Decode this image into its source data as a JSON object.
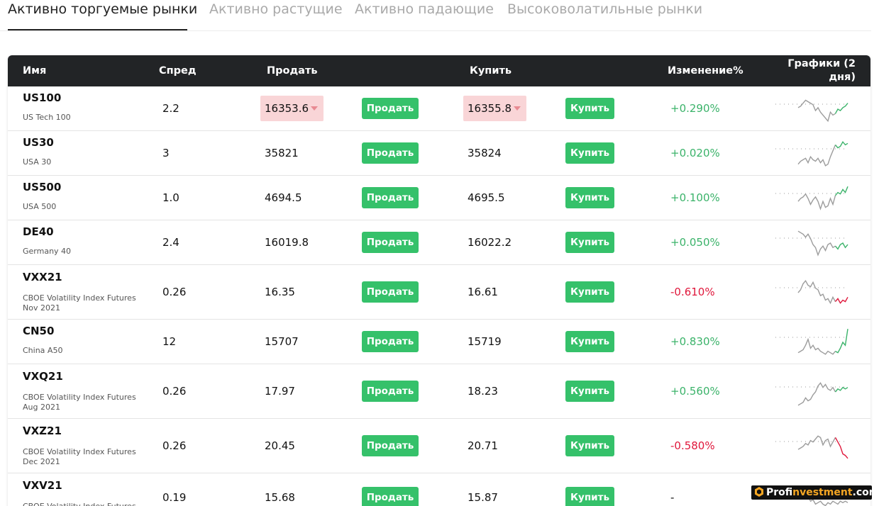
{
  "tabs": [
    {
      "label": "Активно торгуемые рынки",
      "active": true
    },
    {
      "label": "Активно растущие",
      "active": false
    },
    {
      "label": "Активно падающие",
      "active": false
    },
    {
      "label": "Высоковолатильные рынки",
      "active": false
    }
  ],
  "table": {
    "headers": {
      "name": "Имя",
      "spread": "Спред",
      "sell": "Продать",
      "buy": "Купить",
      "change": "Изменение%",
      "charts": "Графики (2 дня)"
    },
    "sell_button_label": "Продать",
    "buy_button_label": "Купить",
    "rows": [
      {
        "symbol": "US100",
        "name": "US Tech 100",
        "spread": "2.2",
        "sell": "16353.6",
        "buy": "16355.8",
        "change": "+0.290%",
        "trend": "up",
        "highlight": true
      },
      {
        "symbol": "US30",
        "name": "USA 30",
        "spread": "3",
        "sell": "35821",
        "buy": "35824",
        "change": "+0.020%",
        "trend": "up",
        "highlight": false
      },
      {
        "symbol": "US500",
        "name": "USA 500",
        "spread": "1.0",
        "sell": "4694.5",
        "buy": "4695.5",
        "change": "+0.100%",
        "trend": "up",
        "highlight": false
      },
      {
        "symbol": "DE40",
        "name": "Germany 40",
        "spread": "2.4",
        "sell": "16019.8",
        "buy": "16022.2",
        "change": "+0.050%",
        "trend": "up",
        "highlight": false
      },
      {
        "symbol": "VXX21",
        "name": "CBOE Volatility Index Futures Nov 2021",
        "spread": "0.26",
        "sell": "16.35",
        "buy": "16.61",
        "change": "-0.610%",
        "trend": "down",
        "highlight": false
      },
      {
        "symbol": "CN50",
        "name": "China A50",
        "spread": "12",
        "sell": "15707",
        "buy": "15719",
        "change": "+0.830%",
        "trend": "up",
        "highlight": false
      },
      {
        "symbol": "VXQ21",
        "name": "CBOE Volatility Index Futures Aug 2021",
        "spread": "0.26",
        "sell": "17.97",
        "buy": "18.23",
        "change": "+0.560%",
        "trend": "up",
        "highlight": false
      },
      {
        "symbol": "VXZ21",
        "name": "CBOE Volatility Index Futures Dec 2021",
        "spread": "0.26",
        "sell": "20.45",
        "buy": "20.71",
        "change": "-0.580%",
        "trend": "down",
        "highlight": false
      },
      {
        "symbol": "VXV21",
        "name": "CBOE Volatility Index Futures",
        "spread": "0.19",
        "sell": "15.68",
        "buy": "15.87",
        "change": "-",
        "trend": "flat",
        "highlight": false
      }
    ]
  },
  "watermark": {
    "prefix": "Prof",
    "highlight": "investment",
    "suffix": ".com"
  },
  "colors": {
    "header_bg": "#222426",
    "button_green": "#35c16a",
    "change_up": "#3bb36a",
    "change_down": "#e0183c",
    "price_down_highlight": "#f9d5d7"
  }
}
